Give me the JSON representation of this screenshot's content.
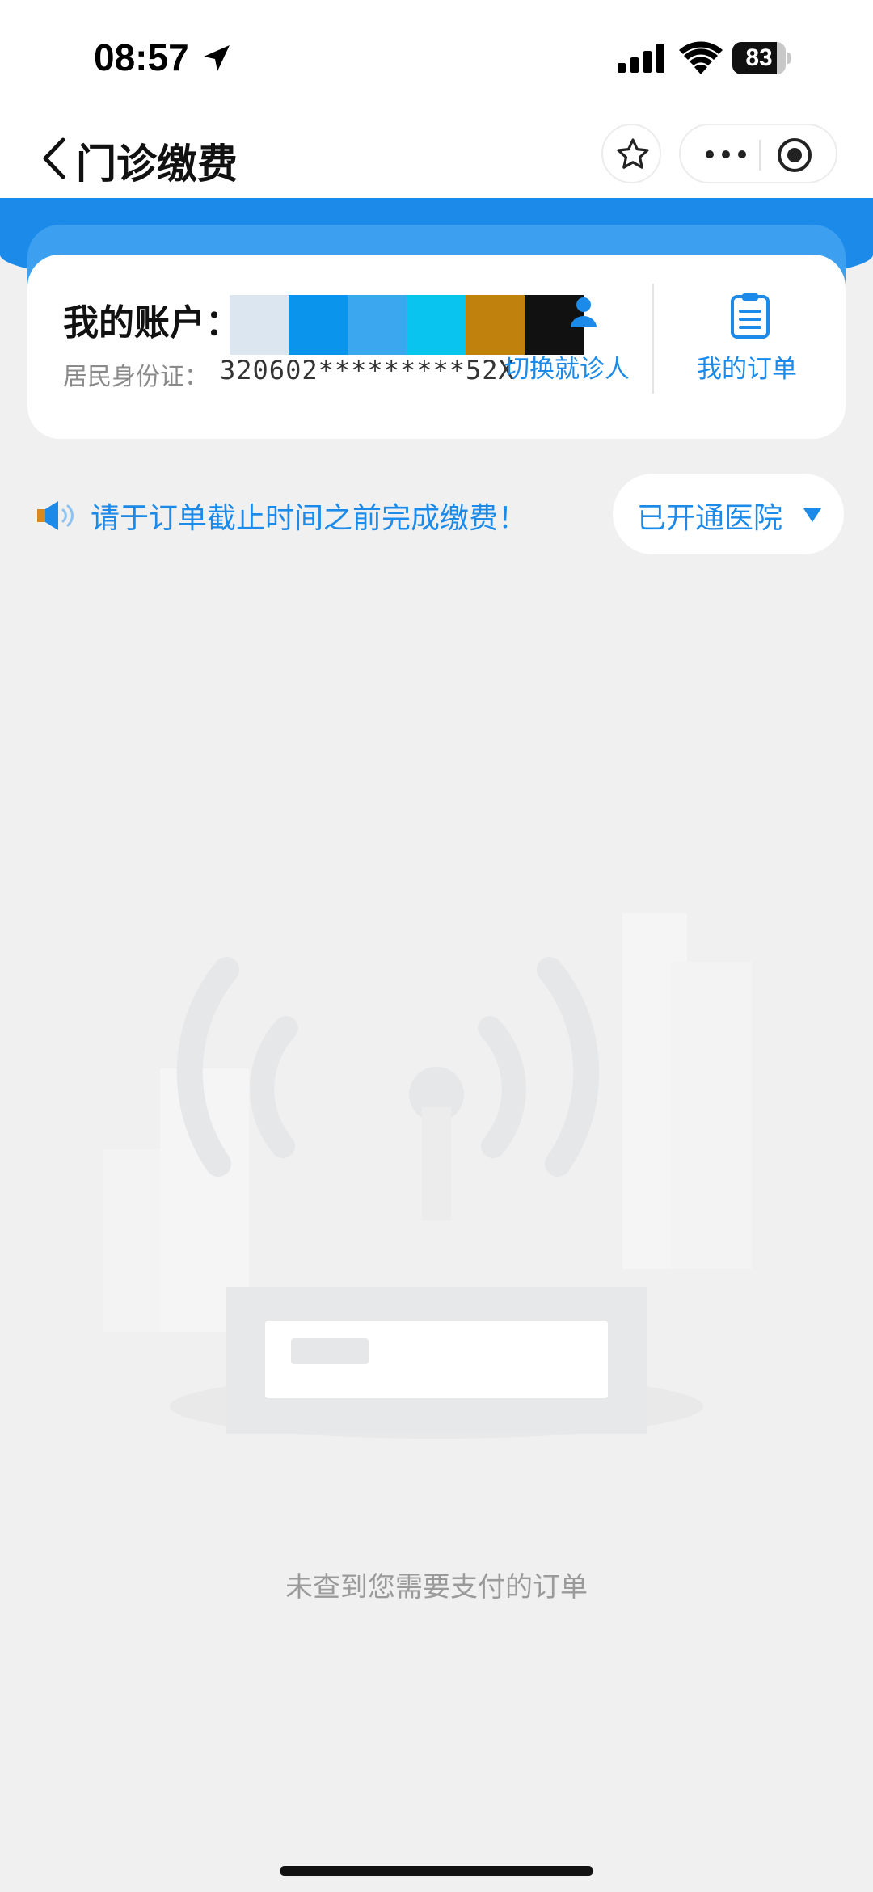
{
  "status_bar": {
    "time": "08:57",
    "battery": "83",
    "battery_level": 0.83,
    "icons": [
      "location-arrow-icon",
      "cellular-signal-icon",
      "wifi-icon",
      "battery-icon"
    ]
  },
  "nav": {
    "title": "门诊缴费",
    "icons": [
      "chevron-left-icon",
      "star-icon",
      "more-icon",
      "close-circle-icon"
    ]
  },
  "account": {
    "label": "我的账户：",
    "id_label": "居民身份证：",
    "id_value": "320602*********52X",
    "switch_label": "切换就诊人",
    "orders_label": "我的订单",
    "redaction_colors": [
      "#dce6f1",
      "#0a94ec",
      "#3aa7ee",
      "#08c4ee",
      "#c0820c",
      "#111111"
    ]
  },
  "notice": {
    "text": "请于订单截止时间之前完成缴费！",
    "hospital_button": "已开通医院"
  },
  "empty_state": {
    "text": "未查到您需要支付的订单"
  },
  "colors": {
    "accent": "#1c8ae9",
    "background": "#f0f0f0",
    "card": "#ffffff"
  }
}
